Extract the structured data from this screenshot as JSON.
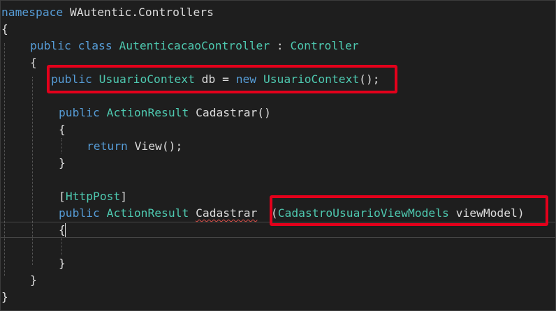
{
  "editor": {
    "language": "C#",
    "theme_colors": {
      "background": "#1e1e1e",
      "keyword": "#569cd6",
      "type": "#4ec9b0",
      "text": "#dcdcdc",
      "highlight_box": "#e3001b",
      "error_squiggle": "#e0504a"
    },
    "lines": [
      [
        {
          "t": "namespace",
          "c": "kw"
        },
        {
          "t": " WAutentic.Controllers",
          "c": "plain"
        }
      ],
      [
        {
          "t": "{",
          "c": "plain"
        }
      ],
      [
        {
          "t": "public",
          "c": "kw"
        },
        {
          "t": " ",
          "c": "plain"
        },
        {
          "t": "class",
          "c": "kw"
        },
        {
          "t": " ",
          "c": "plain"
        },
        {
          "t": "AutenticacaoController",
          "c": "type"
        },
        {
          "t": " : ",
          "c": "plain"
        },
        {
          "t": "Controller",
          "c": "type"
        }
      ],
      [
        {
          "t": "{",
          "c": "plain"
        }
      ],
      [
        {
          "t": "public",
          "c": "kw"
        },
        {
          "t": " ",
          "c": "plain"
        },
        {
          "t": "UsuarioContext",
          "c": "type"
        },
        {
          "t": " db = ",
          "c": "plain"
        },
        {
          "t": "new",
          "c": "kw"
        },
        {
          "t": " ",
          "c": "plain"
        },
        {
          "t": "UsuarioContext",
          "c": "type"
        },
        {
          "t": "();",
          "c": "plain"
        }
      ],
      [],
      [
        {
          "t": "public",
          "c": "kw"
        },
        {
          "t": " ",
          "c": "plain"
        },
        {
          "t": "ActionResult",
          "c": "type"
        },
        {
          "t": " Cadastrar()",
          "c": "plain"
        }
      ],
      [
        {
          "t": "{",
          "c": "plain"
        }
      ],
      [
        {
          "t": "return",
          "c": "kw"
        },
        {
          "t": " View();",
          "c": "plain"
        }
      ],
      [
        {
          "t": "}",
          "c": "plain"
        }
      ],
      [],
      [
        {
          "t": "[",
          "c": "plain"
        },
        {
          "t": "HttpPost",
          "c": "type"
        },
        {
          "t": "]",
          "c": "plain"
        }
      ],
      [
        {
          "t": "public",
          "c": "kw"
        },
        {
          "t": " ",
          "c": "plain"
        },
        {
          "t": "ActionResult",
          "c": "type"
        },
        {
          "t": " ",
          "c": "plain"
        },
        {
          "t": "Cadastrar",
          "c": "plain",
          "err": true
        },
        {
          "t": "  (",
          "c": "plain"
        },
        {
          "t": "CadastroUsuarioViewModels",
          "c": "type"
        },
        {
          "t": " viewModel)",
          "c": "plain"
        }
      ],
      [
        {
          "t": "{",
          "c": "plain"
        }
      ],
      [],
      [
        {
          "t": "}",
          "c": "plain"
        }
      ],
      [
        {
          "t": "}",
          "c": "plain"
        }
      ],
      [
        {
          "t": "}",
          "c": "plain"
        }
      ]
    ]
  }
}
